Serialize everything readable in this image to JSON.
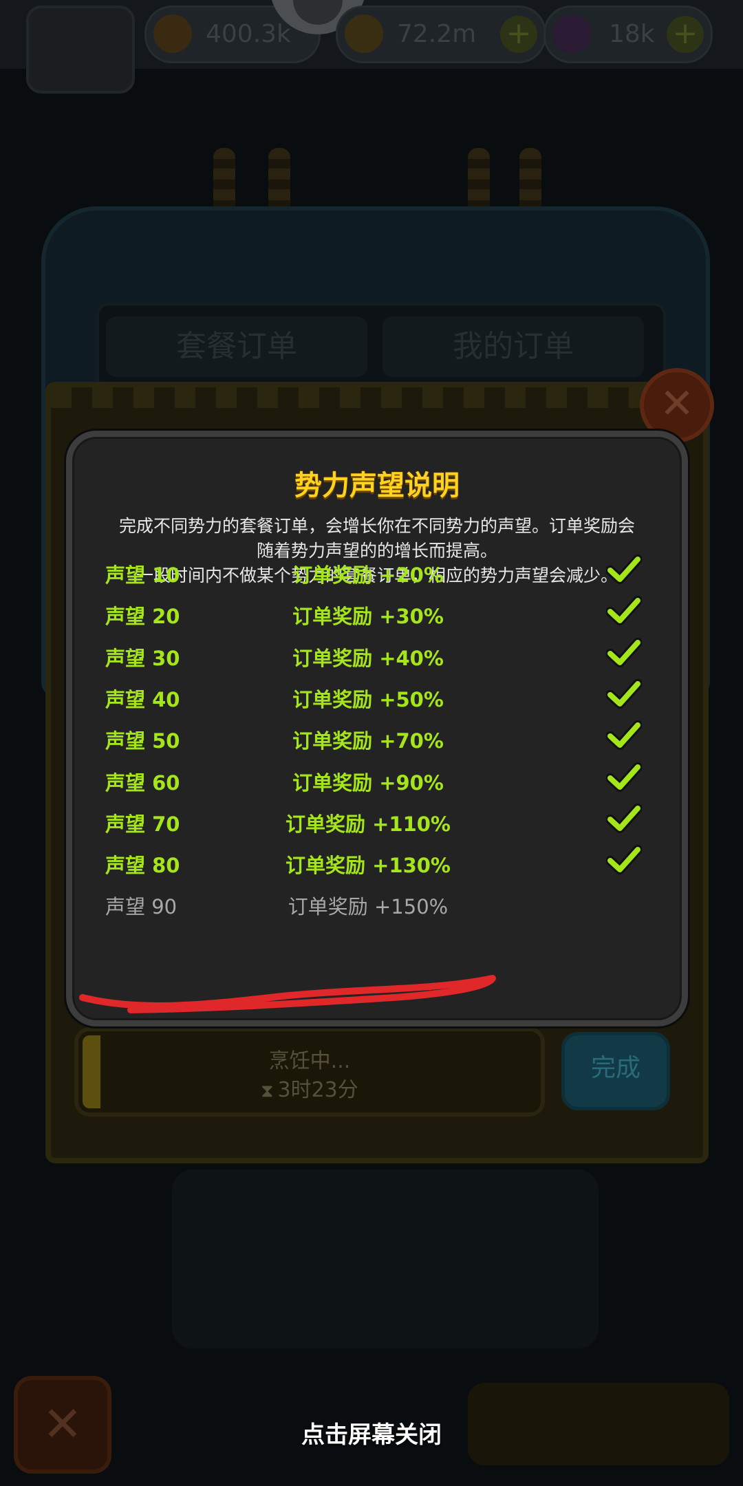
{
  "background": {
    "resources": [
      {
        "name": "gold",
        "value": "400.3k",
        "color": "#3a2a12"
      },
      {
        "name": "coins",
        "value": "72.2m",
        "color": "#3a2e12"
      },
      {
        "name": "potion",
        "value": "18k",
        "color": "#2a1a33"
      }
    ],
    "tabs": [
      "套餐订单",
      "我的订单"
    ],
    "cooking": {
      "status": "烹饪中...",
      "time_left": "3时23分"
    },
    "done_label": "完成"
  },
  "dialog": {
    "title": "势力声望说明",
    "description": [
      "完成不同势力的套餐订单，会增长你在不同势力的声望。订单奖励会",
      "随着势力声望的的增长而提高。",
      "一段时间内不做某个势力的套餐订单，相应的势力声望会减少。"
    ],
    "rows": [
      {
        "level": "声望 10",
        "bonus": "订单奖励 +20%",
        "achieved": true
      },
      {
        "level": "声望 20",
        "bonus": "订单奖励 +30%",
        "achieved": true
      },
      {
        "level": "声望 30",
        "bonus": "订单奖励 +40%",
        "achieved": true
      },
      {
        "level": "声望 40",
        "bonus": "订单奖励 +50%",
        "achieved": true
      },
      {
        "level": "声望 50",
        "bonus": "订单奖励 +70%",
        "achieved": true
      },
      {
        "level": "声望 60",
        "bonus": "订单奖励 +90%",
        "achieved": true
      },
      {
        "level": "声望 70",
        "bonus": "订单奖励 +110%",
        "achieved": true
      },
      {
        "level": "声望 80",
        "bonus": "订单奖励 +130%",
        "achieved": true
      },
      {
        "level": "声望 90",
        "bonus": "订单奖励 +150%",
        "achieved": false
      }
    ],
    "colors": {
      "achieved": "#a5e61a",
      "locked": "#a8a8a8",
      "title": "#ffd21e",
      "annotation": "#e0282a"
    }
  },
  "close_hint": "点击屏幕关闭"
}
